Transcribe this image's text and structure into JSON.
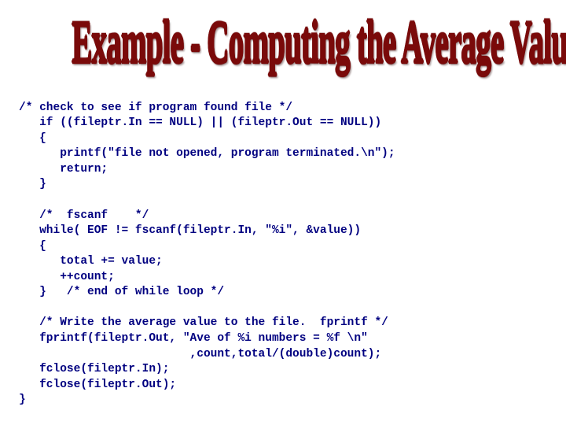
{
  "title": "Example - Computing the Average Value",
  "code": {
    "l1": "/* check to see if program found file */",
    "l2": "   if ((fileptr.In == NULL) || (fileptr.Out == NULL))",
    "l3": "   {",
    "l4": "      printf(\"file not opened, program terminated.\\n\");",
    "l5": "      return;",
    "l6": "   }",
    "l7": "",
    "l8": "   /*  fscanf    */",
    "l9": "   while( EOF != fscanf(fileptr.In, \"%i\", &value))",
    "l10": "   {",
    "l11": "      total += value;",
    "l12": "      ++count;",
    "l13": "   }   /* end of while loop */",
    "l14": "",
    "l15": "   /* Write the average value to the file.  fprintf */",
    "l16": "   fprintf(fileptr.Out, \"Ave of %i numbers = %f \\n\"",
    "l17": "                         ,count,total/(double)count);",
    "l18": "   fclose(fileptr.In);",
    "l19": "   fclose(fileptr.Out);",
    "l20": "}"
  }
}
